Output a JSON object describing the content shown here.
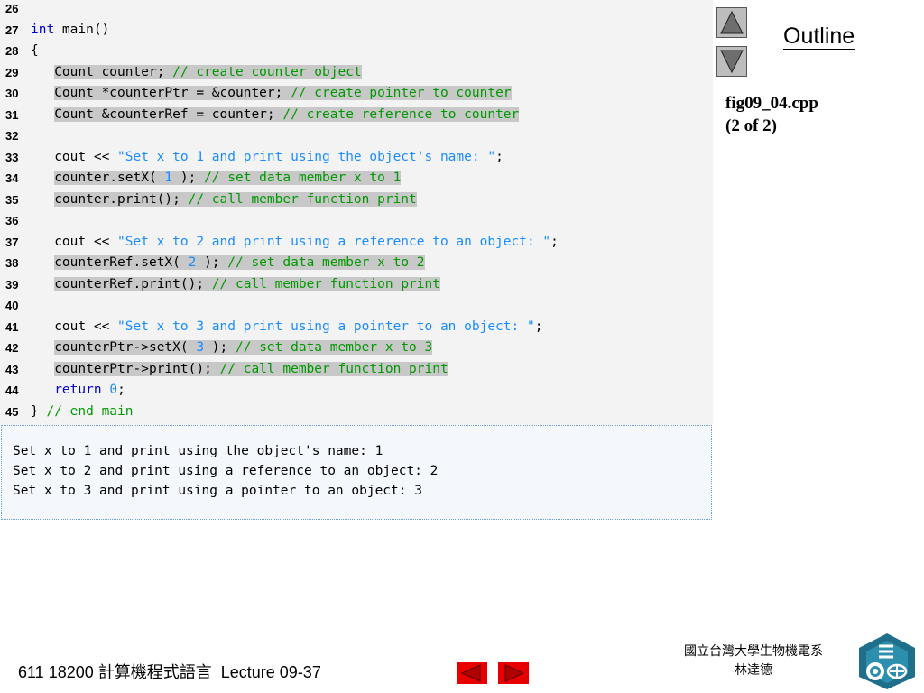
{
  "code_lines": [
    {
      "num": "26",
      "segments": []
    },
    {
      "num": "27",
      "segments": [
        {
          "t": "int",
          "c": "kw"
        },
        {
          "t": " main()",
          "c": ""
        }
      ]
    },
    {
      "num": "28",
      "segments": [
        {
          "t": "{",
          "c": ""
        }
      ]
    },
    {
      "num": "29",
      "hl": true,
      "segments": [
        {
          "t": "   Count counter; ",
          "c": ""
        },
        {
          "t": "// create counter object",
          "c": "cm"
        }
      ]
    },
    {
      "num": "30",
      "hl": true,
      "segments": [
        {
          "t": "   Count *counterPtr = &counter; ",
          "c": ""
        },
        {
          "t": "// create pointer to counter",
          "c": "cm"
        }
      ]
    },
    {
      "num": "31",
      "hl": true,
      "segments": [
        {
          "t": "   Count &counterRef = counter; ",
          "c": ""
        },
        {
          "t": "// create reference to counter",
          "c": "cm"
        }
      ]
    },
    {
      "num": "32",
      "segments": []
    },
    {
      "num": "33",
      "segments": [
        {
          "t": "   cout << ",
          "c": ""
        },
        {
          "t": "\"Set x to 1 and print using the object's name: \"",
          "c": "str"
        },
        {
          "t": ";",
          "c": ""
        }
      ]
    },
    {
      "num": "34",
      "hl": true,
      "segments": [
        {
          "t": "   counter.setX( ",
          "c": ""
        },
        {
          "t": "1",
          "c": "num"
        },
        {
          "t": " ); ",
          "c": ""
        },
        {
          "t": "// set data member x to 1",
          "c": "cm"
        }
      ]
    },
    {
      "num": "35",
      "hl": true,
      "segments": [
        {
          "t": "   counter.print(); ",
          "c": ""
        },
        {
          "t": "// call member function print",
          "c": "cm"
        }
      ]
    },
    {
      "num": "36",
      "segments": []
    },
    {
      "num": "37",
      "segments": [
        {
          "t": "   cout << ",
          "c": ""
        },
        {
          "t": "\"Set x to 2 and print using a reference to an object: \"",
          "c": "str"
        },
        {
          "t": ";",
          "c": ""
        }
      ]
    },
    {
      "num": "38",
      "hl": true,
      "segments": [
        {
          "t": "   counterRef.setX( ",
          "c": ""
        },
        {
          "t": "2",
          "c": "num"
        },
        {
          "t": " ); ",
          "c": ""
        },
        {
          "t": "// set data member x to 2",
          "c": "cm"
        }
      ]
    },
    {
      "num": "39",
      "hl": true,
      "segments": [
        {
          "t": "   counterRef.print(); ",
          "c": ""
        },
        {
          "t": "// call member function print",
          "c": "cm"
        }
      ]
    },
    {
      "num": "40",
      "segments": []
    },
    {
      "num": "41",
      "segments": [
        {
          "t": "   cout << ",
          "c": ""
        },
        {
          "t": "\"Set x to 3 and print using a pointer to an object: \"",
          "c": "str"
        },
        {
          "t": ";",
          "c": ""
        }
      ]
    },
    {
      "num": "42",
      "hl": true,
      "segments": [
        {
          "t": "   counterPtr->setX( ",
          "c": ""
        },
        {
          "t": "3",
          "c": "num"
        },
        {
          "t": " ); ",
          "c": ""
        },
        {
          "t": "// set data member x to 3",
          "c": "cm"
        }
      ]
    },
    {
      "num": "43",
      "hl": true,
      "segments": [
        {
          "t": "   counterPtr->print(); ",
          "c": ""
        },
        {
          "t": "// call member function print",
          "c": "cm"
        }
      ]
    },
    {
      "num": "44",
      "segments": [
        {
          "t": "   ",
          "c": ""
        },
        {
          "t": "return",
          "c": "kw"
        },
        {
          "t": " ",
          "c": ""
        },
        {
          "t": "0",
          "c": "num"
        },
        {
          "t": ";",
          "c": ""
        }
      ]
    },
    {
      "num": "45",
      "segments": [
        {
          "t": "} ",
          "c": ""
        },
        {
          "t": "// end main",
          "c": "cm"
        }
      ]
    }
  ],
  "output_lines": [
    "Set x to 1 and print using the object's name: 1",
    "Set x to 2 and print using a reference to an object: 2",
    "Set x to 3 and print using a pointer to an object: 3"
  ],
  "sidebar": {
    "outline_label": "Outline",
    "up_icon": "triangle-up-icon",
    "down_icon": "triangle-down-icon",
    "file_name": "fig09_04.cpp",
    "page_info": "(2 of 2)"
  },
  "footer": {
    "course": "611 18200 計算機程式語言  Lecture 09-37",
    "institution_line1": "國立台灣大學生物機電系",
    "institution_line2": "林達德",
    "prev_icon": "arrow-left-icon",
    "next_icon": "arrow-right-icon"
  },
  "colors": {
    "keyword": "#0000cc",
    "string": "#1a8cff",
    "comment": "#009900",
    "highlight": "#c8c8c8",
    "nav_arrow": "#e60000"
  }
}
